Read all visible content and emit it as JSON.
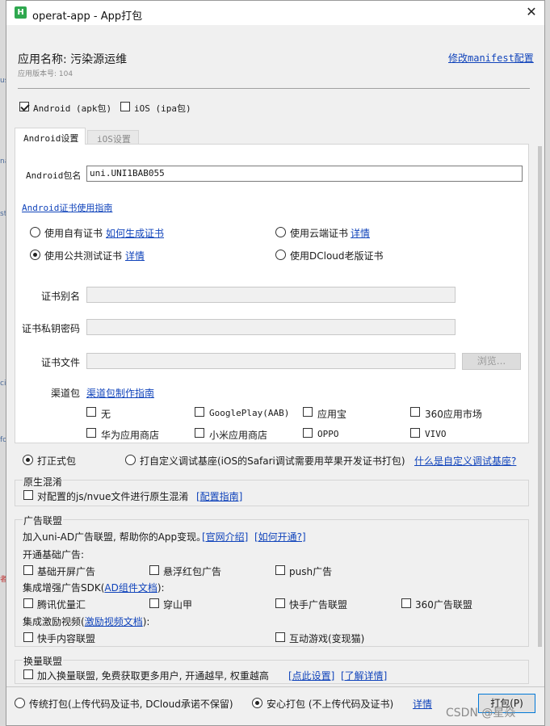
{
  "window": {
    "title": "operat-app - App打包",
    "close": "✕"
  },
  "header": {
    "app_name_label": "应用名称: 污染源运维",
    "version_label": "应用版本号: 104",
    "manifest_link": "修改manifest配置"
  },
  "platforms": {
    "android": "Android (apk包)",
    "ios": "iOS (ipa包)"
  },
  "tabs": {
    "android": "Android设置",
    "ios": "iOS设置"
  },
  "android": {
    "package_label": "Android包名",
    "package_value": "uni.UNI1BAB055",
    "cert_guide": "Android证书使用指南",
    "cert_options": {
      "own": "使用自有证书",
      "own_link": "如何生成证书",
      "cloud": "使用云端证书",
      "cloud_link": "详情",
      "public_test": "使用公共测试证书",
      "public_test_link": "详情",
      "dcloud_old": "使用DCloud老版证书"
    },
    "cert_alias_label": "证书别名",
    "cert_password_label": "证书私钥密码",
    "cert_file_label": "证书文件",
    "browse_button": "浏览...",
    "channel_label": "渠道包",
    "channel_link": "渠道包制作指南",
    "channels": [
      "无",
      "GooglePlay(AAB)",
      "应用宝",
      "360应用市场",
      "华为应用商店",
      "小米应用商店",
      "OPPO",
      "VIVO"
    ]
  },
  "build_type": {
    "formal": "打正式包",
    "custom_base": "打自定义调试基座(iOS的Safari调试需要用苹果开发证书打包)",
    "custom_link": "什么是自定义调试基座?"
  },
  "obfuscation": {
    "title": "原生混淆",
    "checkbox": "对配置的js/nvue文件进行原生混淆",
    "link": "[配置指南]"
  },
  "ad": {
    "title": "广告联盟",
    "intro": "加入uni-AD广告联盟, 帮助你的App变现。",
    "intro_link1": "[官网介绍]",
    "intro_link2": "[如何开通?]",
    "basic_label": "开通基础广告:",
    "basic": [
      "基础开屏广告",
      "悬浮红包广告",
      "push广告"
    ],
    "enhanced_prefix": "集成增强广告SDK(",
    "enhanced_link": "AD组件文档",
    "enhanced_suffix": "):",
    "enhanced": [
      "腾讯优量汇",
      "穿山甲",
      "快手广告联盟",
      "360广告联盟"
    ],
    "video_prefix": "集成激励视频(",
    "video_link": "激励视频文档",
    "video_suffix": "):",
    "video": [
      "快手内容联盟",
      "互动游戏(变现猫)"
    ]
  },
  "exchange": {
    "title": "换量联盟",
    "checkbox": "加入换量联盟, 免费获取更多用户, 开通越早, 权重越高",
    "link1": "[点此设置]",
    "link2": "[了解详情]"
  },
  "footer": {
    "traditional": "传统打包(上传代码及证书, DCloud承诺不保留)",
    "safe": "安心打包 (不上传代码及证书)",
    "detail_link": "详情",
    "pack_button": "打包(P)"
  },
  "watermark": "CSDN @星焱",
  "colors": {
    "link": "#1144bb",
    "logo": "#2fa84f"
  }
}
